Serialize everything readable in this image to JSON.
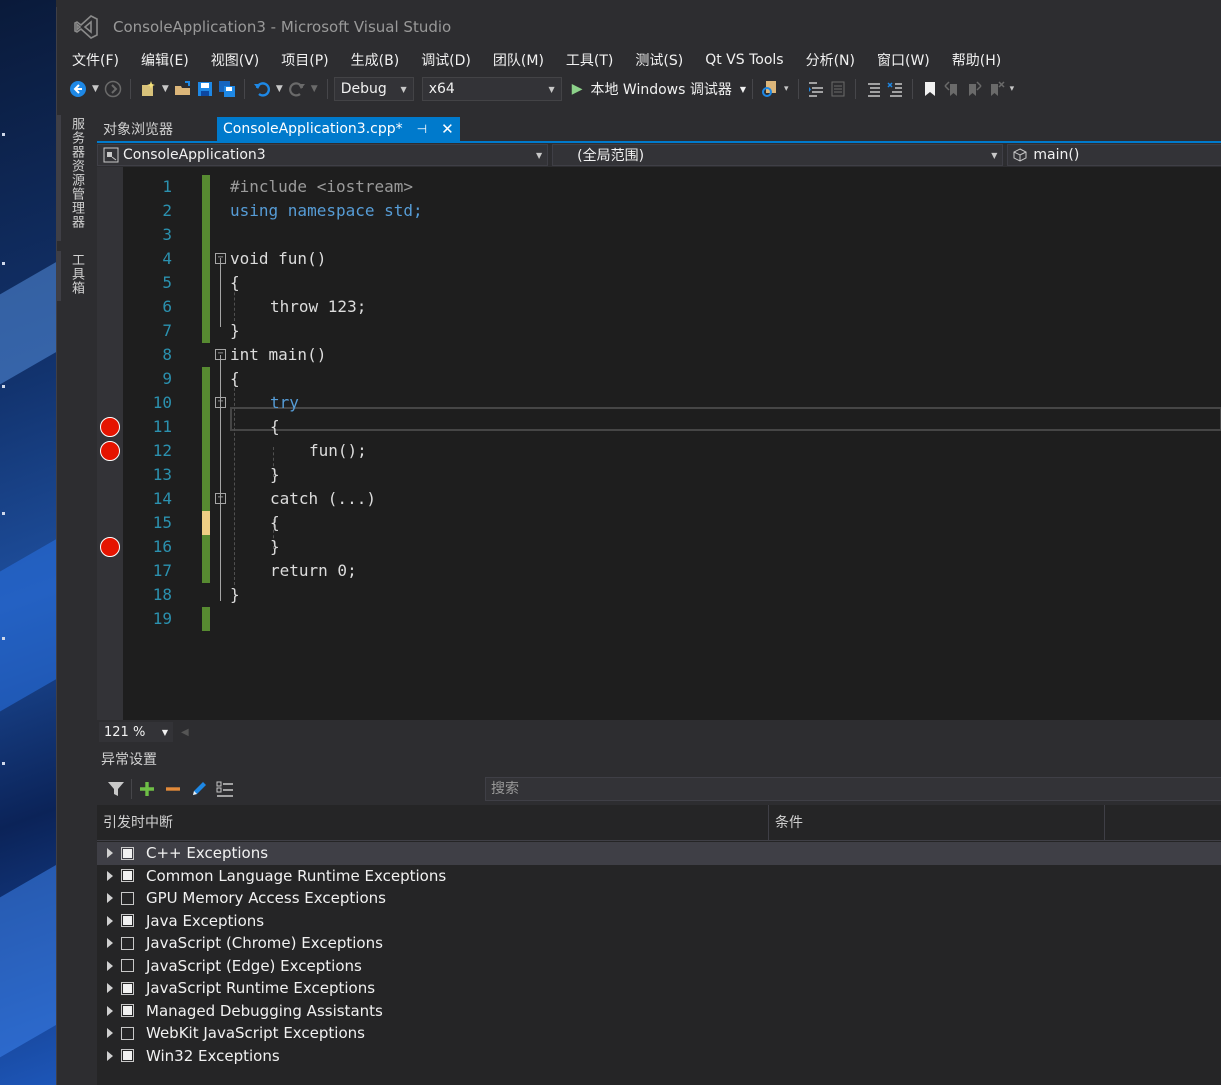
{
  "window": {
    "title": "ConsoleApplication3 - Microsoft Visual Studio"
  },
  "menu": [
    "文件(F)",
    "编辑(E)",
    "视图(V)",
    "项目(P)",
    "生成(B)",
    "调试(D)",
    "团队(M)",
    "工具(T)",
    "测试(S)",
    "Qt VS Tools",
    "分析(N)",
    "窗口(W)",
    "帮助(H)"
  ],
  "toolbar": {
    "config": "Debug",
    "platform": "x64",
    "run_label": "本地 Windows 调试器"
  },
  "side_tabs": [
    "服务器资源管理器",
    "工具箱"
  ],
  "doc_tabs": {
    "inactive": "对象浏览器",
    "active": "ConsoleApplication3.cpp*"
  },
  "nav": {
    "project": "ConsoleApplication3",
    "scope": "(全局范围)",
    "member": "main()"
  },
  "code_lines": [
    {
      "n": "1",
      "text": "#include <iostream>"
    },
    {
      "n": "2",
      "text": "using namespace std;"
    },
    {
      "n": "3",
      "text": ""
    },
    {
      "n": "4",
      "text": "void fun()"
    },
    {
      "n": "5",
      "text": "{"
    },
    {
      "n": "6",
      "text": "throw 123;"
    },
    {
      "n": "7",
      "text": "}"
    },
    {
      "n": "8",
      "text": "int main()"
    },
    {
      "n": "9",
      "text": "{"
    },
    {
      "n": "10",
      "text": "try"
    },
    {
      "n": "11",
      "text": "{"
    },
    {
      "n": "12",
      "text": "fun();"
    },
    {
      "n": "13",
      "text": "}"
    },
    {
      "n": "14",
      "text": "catch (...)"
    },
    {
      "n": "15",
      "text": "{"
    },
    {
      "n": "16",
      "text": "}"
    },
    {
      "n": "17",
      "text": "return 0;"
    },
    {
      "n": "18",
      "text": "}"
    },
    {
      "n": "19",
      "text": ""
    }
  ],
  "breakpoint_lines": [
    11,
    12,
    16
  ],
  "zoom": "121 %",
  "exception_panel": {
    "title": "异常设置",
    "search_placeholder": "搜索",
    "col_break": "引发时中断",
    "col_condition": "条件",
    "rows": [
      {
        "label": "C++ Exceptions",
        "checked": true
      },
      {
        "label": "Common Language Runtime Exceptions",
        "checked": true
      },
      {
        "label": "GPU Memory Access Exceptions",
        "checked": false
      },
      {
        "label": "Java Exceptions",
        "checked": true
      },
      {
        "label": "JavaScript (Chrome) Exceptions",
        "checked": false
      },
      {
        "label": "JavaScript (Edge) Exceptions",
        "checked": false
      },
      {
        "label": "JavaScript Runtime Exceptions",
        "checked": true
      },
      {
        "label": "Managed Debugging Assistants",
        "checked": true
      },
      {
        "label": "WebKit JavaScript Exceptions",
        "checked": false
      },
      {
        "label": "Win32 Exceptions",
        "checked": true
      }
    ]
  },
  "colors": {
    "accent": "#007acc",
    "keyword": "#569cd6",
    "line_number": "#2b91af",
    "breakpoint": "#e51400",
    "change_saved": "#578a31",
    "change_unsaved": "#efce84"
  }
}
